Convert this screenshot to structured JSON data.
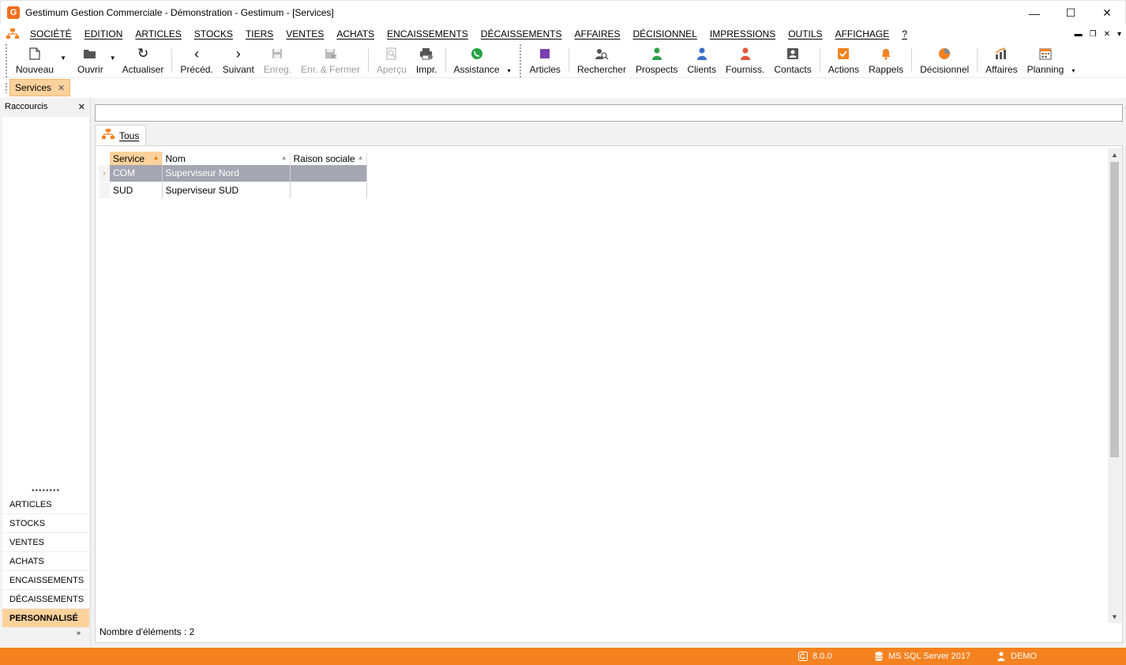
{
  "window": {
    "title": "Gestimum Gestion Commerciale - Démonstration - Gestimum - [Services]",
    "logo_letter": "G",
    "controls": {
      "minimize": "—",
      "maximize": "☐",
      "close": "✕"
    }
  },
  "menubar": {
    "items": [
      "SOCIÉTÉ",
      "EDITION",
      "ARTICLES",
      "STOCKS",
      "TIERS",
      "VENTES",
      "ACHATS",
      "ENCAISSEMENTS",
      "DÉCAISSEMENTS",
      "AFFAIRES",
      "DÉCISIONNEL",
      "IMPRESSIONS",
      "OUTILS",
      "AFFICHAGE",
      "?"
    ],
    "mdi": {
      "minimize": "▬",
      "restore": "❐",
      "close": "✕",
      "more": "▾"
    }
  },
  "toolbar": {
    "nouveau": "Nouveau",
    "ouvrir": "Ouvrir",
    "actualiser": "Actualiser",
    "preced": "Précéd.",
    "suivant": "Suivant",
    "enreg": "Enreg.",
    "enr_fermer": "Enr. & Fermer",
    "apercu": "Aperçu",
    "impr": "Impr.",
    "assistance": "Assistance",
    "articles": "Articles",
    "rechercher": "Rechercher",
    "prospects": "Prospects",
    "clients": "Clients",
    "fourniss": "Fourniss.",
    "contacts": "Contacts",
    "actions": "Actions",
    "rappels": "Rappels",
    "decisionnel": "Décisionnel",
    "affaires": "Affaires",
    "planning": "Planning",
    "more": "▾",
    "colors": {
      "whatsapp": "#25a244",
      "articles": "#7a3fb0",
      "prospects": "#2e9e4a",
      "clients": "#3a6fc4",
      "fourniss": "#e2553b",
      "contacts": "#555555",
      "orange": "#f58220"
    }
  },
  "doctabs": {
    "services": "Services",
    "close": "✕"
  },
  "leftpanel": {
    "title": "Raccourcis",
    "close": "✕",
    "dots": "••••••••",
    "nav": [
      "ARTICLES",
      "STOCKS",
      "VENTES",
      "ACHATS",
      "ENCAISSEMENTS",
      "DÉCAISSEMENTS",
      "PERSONNALISÉ"
    ],
    "more": "»"
  },
  "main": {
    "filter_value": "",
    "tab": "Tous",
    "columns": [
      "Service",
      "Nom",
      "Raison sociale"
    ],
    "rows": [
      {
        "indicator": "›",
        "service": "COM",
        "nom": "Superviseur Nord",
        "raison": ""
      },
      {
        "indicator": "",
        "service": "SUD",
        "nom": "Superviseur SUD",
        "raison": ""
      }
    ],
    "count_label": "Nombre d'éléments : 2",
    "scroll_up": "▲",
    "scroll_down": "▼"
  },
  "statusbar": {
    "version": "8.0.0",
    "database": "MS SQL Server 2017",
    "user": "DEMO",
    "accent": "#f58220"
  }
}
